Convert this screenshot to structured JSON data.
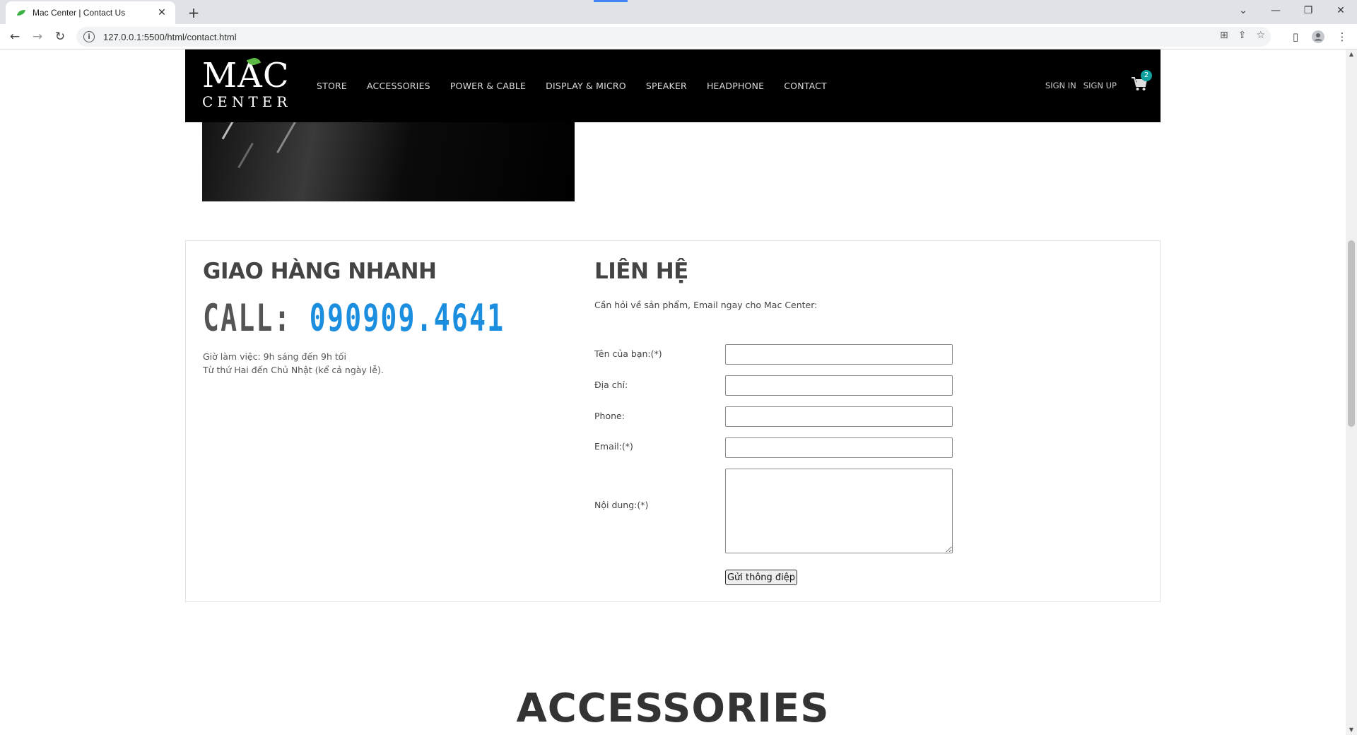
{
  "browser": {
    "tab_title": "Mac Center | Contact Us",
    "tab_close": "✕",
    "new_tab": "+",
    "url": "127.0.0.1:5500/html/contact.html",
    "controls": {
      "dropdown": "⌄",
      "minimize": "—",
      "restore": "❐",
      "close": "✕"
    }
  },
  "header": {
    "logo_top": "MAC",
    "logo_bottom": "CENTER",
    "nav": [
      {
        "label": "STORE"
      },
      {
        "label": "ACCESSORIES"
      },
      {
        "label": "POWER & CABLE"
      },
      {
        "label": "DISPLAY & MICRO"
      },
      {
        "label": "SPEAKER"
      },
      {
        "label": "HEADPHONE"
      },
      {
        "label": "CONTACT"
      }
    ],
    "sign_in": "SIGN IN",
    "sign_up": "SIGN UP",
    "cart_count": "2"
  },
  "delivery": {
    "title": "GIAO HÀNG NHANH",
    "call_prefix": "CALL: ",
    "phone": "090909.4641",
    "hours_line1": "Giờ làm việc: 9h sáng đến 9h tối",
    "hours_line2": "Từ thứ Hai đến Chủ Nhật (kể cả ngày lễ)."
  },
  "contact": {
    "title": "LIÊN HỆ",
    "subtitle": "Cần hỏi về sản phẩm, Email ngay cho Mac Center:",
    "fields": {
      "name_label": "Tên của bạn:(*)",
      "name_value": "",
      "address_label": "Địa chỉ:",
      "address_value": "",
      "phone_label": "Phone:",
      "phone_value": "",
      "email_label": "Email:(*)",
      "email_value": "",
      "message_label": "Nội dung:(*)",
      "message_value": ""
    },
    "submit_label": "Gửi thông điệp"
  },
  "accessories_heading": "ACCESSORIES",
  "colors": {
    "header_bg": "#000000",
    "phone_accent": "#1b8ee0",
    "cart_badge": "#10a0a0",
    "leaf": "#5cb944"
  }
}
